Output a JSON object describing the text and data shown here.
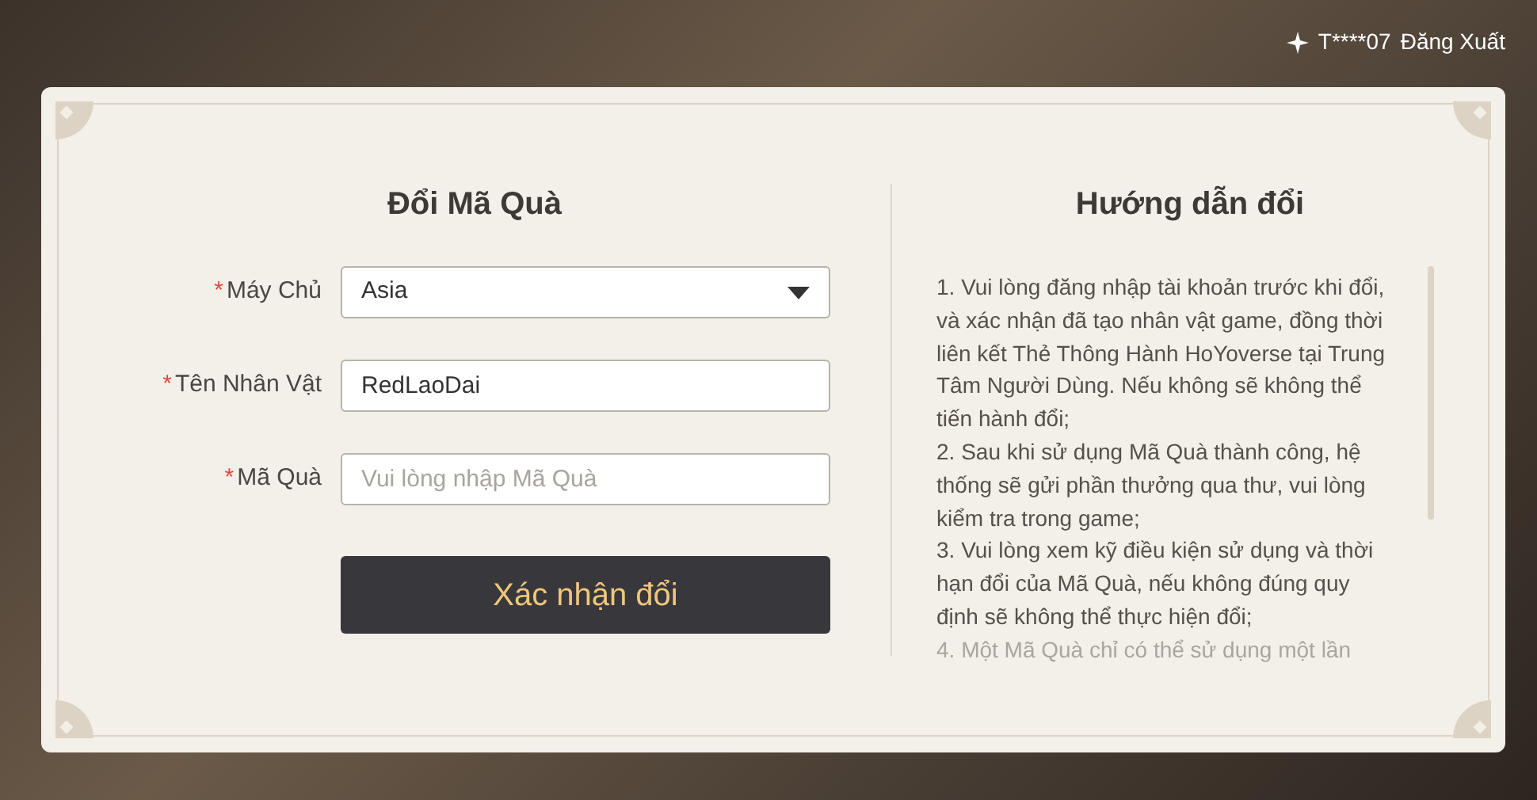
{
  "header": {
    "user": "T****07",
    "logout": "Đăng Xuất"
  },
  "redeem": {
    "title": "Đổi Mã Quà",
    "fields": [
      {
        "kind": "select",
        "label": "Máy Chủ",
        "required_mark": "*",
        "value": "Asia"
      },
      {
        "kind": "text",
        "label": "Tên Nhân Vật",
        "required_mark": "*",
        "value": "RedLaoDai"
      },
      {
        "kind": "text",
        "label": "Mã Quà",
        "required_mark": "*",
        "placeholder": "Vui lòng nhập Mã Quà"
      }
    ],
    "submit": "Xác nhận đổi"
  },
  "guide": {
    "title": "Hướng dẫn đổi",
    "items": [
      {
        "text": "1. Vui lòng đăng nhập tài khoản trước khi đổi, và xác nhận đã tạo nhân vật game, đồng thời liên kết Thẻ Thông Hành HoYoverse tại Trung Tâm Người Dùng. Nếu không sẽ không thể tiến hành đổi;",
        "faded": false
      },
      {
        "text": "2. Sau khi sử dụng Mã Quà thành công, hệ thống sẽ gửi phần thưởng qua thư, vui lòng kiểm tra trong game;",
        "faded": false
      },
      {
        "text": "3. Vui lòng xem kỹ điều kiện sử dụng và thời hạn đổi của Mã Quà, nếu không đúng quy định sẽ không thể thực hiện đổi;",
        "faded": false
      },
      {
        "text": "4. Một Mã Quà chỉ có thể sử dụng một lần",
        "faded": true
      }
    ]
  }
}
